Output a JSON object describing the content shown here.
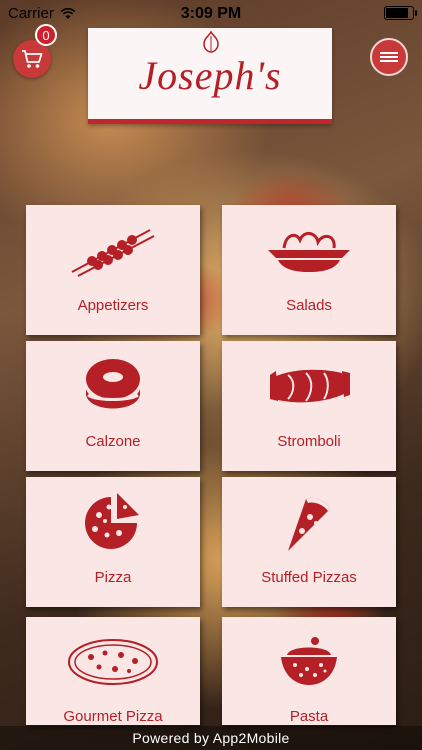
{
  "status_bar": {
    "carrier": "Carrier",
    "time": "3:09 PM"
  },
  "header": {
    "logo_text": "Joseph's",
    "cart_count": "0"
  },
  "menu_tiles": [
    {
      "label": "Appetizers",
      "icon": "skewers-icon"
    },
    {
      "label": "Salads",
      "icon": "salad-bowl-icon"
    },
    {
      "label": "Calzone",
      "icon": "calzone-icon"
    },
    {
      "label": "Stromboli",
      "icon": "stromboli-icon"
    },
    {
      "label": "Pizza",
      "icon": "pizza-icon"
    },
    {
      "label": "Stuffed Pizzas",
      "icon": "pizza-slice-icon"
    },
    {
      "label": "Gourmet Pizza",
      "icon": "gourmet-pizza-icon"
    },
    {
      "label": "Pasta",
      "icon": "pasta-bowl-icon"
    }
  ],
  "footer": {
    "powered_by": "Powered by App2Mobile"
  },
  "colors": {
    "brand_red": "#b51f26",
    "tile_bg": "#fbe6e6"
  }
}
